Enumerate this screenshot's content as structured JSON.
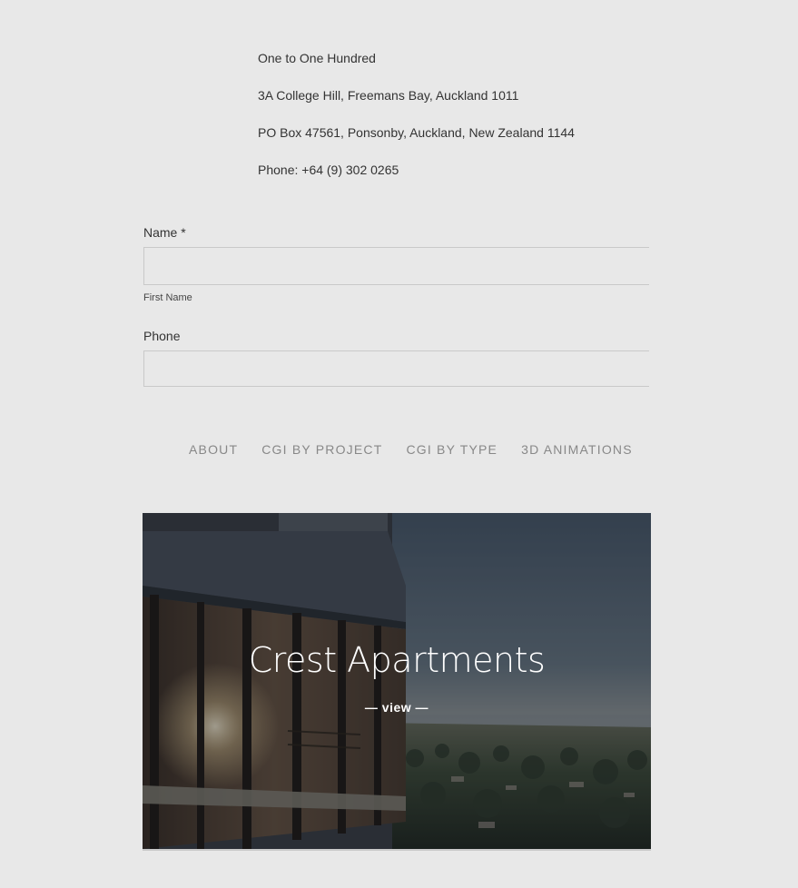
{
  "contact": {
    "company": "One to One Hundred",
    "street_address": "3A College Hill, Freemans Bay, Auckland 1011",
    "po_box": "PO Box 47561, Ponsonby, Auckland, New Zealand 1144",
    "phone": "Phone: +64 (9) 302 0265"
  },
  "form": {
    "name_label": "Name *",
    "name_value": "",
    "first_name_sublabel": "First Name",
    "phone_label": "Phone",
    "phone_value": ""
  },
  "nav": {
    "items": [
      {
        "label": "ABOUT"
      },
      {
        "label": "CGI BY PROJECT"
      },
      {
        "label": "CGI BY TYPE"
      },
      {
        "label": "3D ANIMATIONS"
      }
    ]
  },
  "project_card": {
    "title": "Crest Apartments",
    "view_label": "— view —"
  },
  "colors": {
    "page_background": "#e8e8e8",
    "text": "#333333",
    "nav_text": "#888888",
    "input_border": "#c9c9c9"
  }
}
